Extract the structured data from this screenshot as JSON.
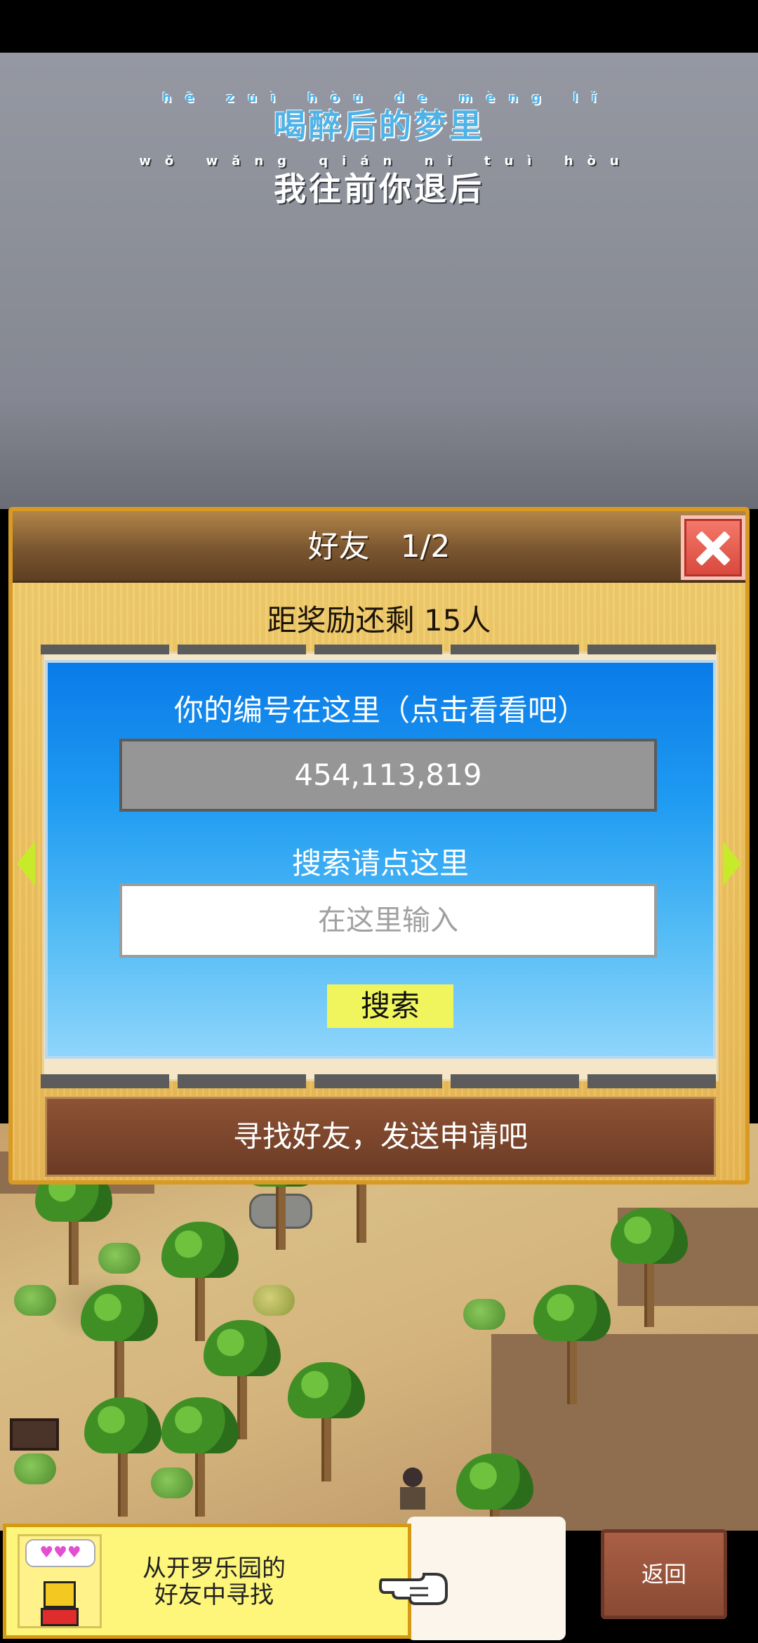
{
  "lyrics": [
    {
      "pinyin": "hē zuì hòu de mèng lǐ",
      "text": "喝醉后的梦里"
    },
    {
      "pinyin": "wǒ wǎng qián nǐ tuì hòu",
      "text": "我往前你退后"
    }
  ],
  "dialog": {
    "title": "好友　1/2",
    "reward_text": "距奖励还剩 15人",
    "id_label": "你的编号在这里（点击看看吧）",
    "player_id": "454,113,819",
    "search_label": "搜索请点这里",
    "search_placeholder": "在这里输入",
    "search_button": "搜索",
    "find_friends_button": "寻找好友，发送申请吧"
  },
  "bottom": {
    "banner_text_line1": "从开罗乐园的",
    "banner_text_line2": "好友中寻找",
    "mascot_hearts": "♥♥♥",
    "back_button": "返回"
  },
  "colors": {
    "dialog_border": "#d89a23",
    "panel_blue": "#1f9bf2",
    "search_button": "#f0f55e",
    "close_button": "#d9473c",
    "arrow": "#c7ea2a"
  }
}
